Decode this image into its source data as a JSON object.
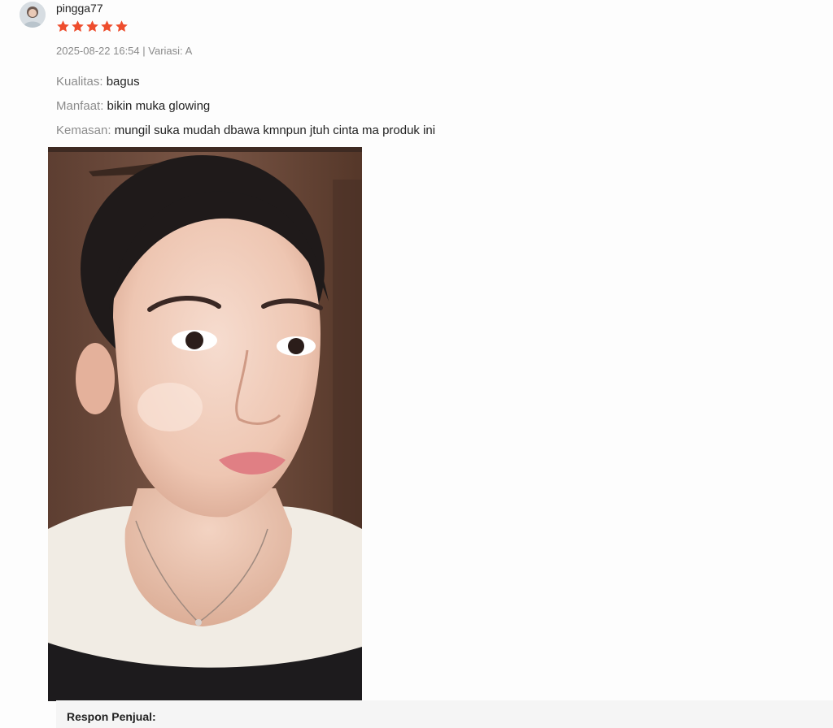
{
  "review": {
    "username": "pingga77",
    "rating": 5,
    "date": "2025-08-22 16:54",
    "separator": " | ",
    "variation_label": "Variasi:",
    "variation_value": "A",
    "attributes": [
      {
        "label": "Kualitas:",
        "value": "bagus"
      },
      {
        "label": "Manfaat:",
        "value": "bikin muka glowing"
      },
      {
        "label": "Kemasan:",
        "value": "mungil suka mudah dbawa kmnpun jtuh cinta ma produk ini"
      }
    ]
  },
  "seller_response": {
    "label": "Respon Penjual:"
  },
  "icons": {
    "avatar": "avatar",
    "star": "star-icon"
  },
  "colors": {
    "star": "#ee4d2d",
    "seller_bg": "#f5f5f5"
  }
}
